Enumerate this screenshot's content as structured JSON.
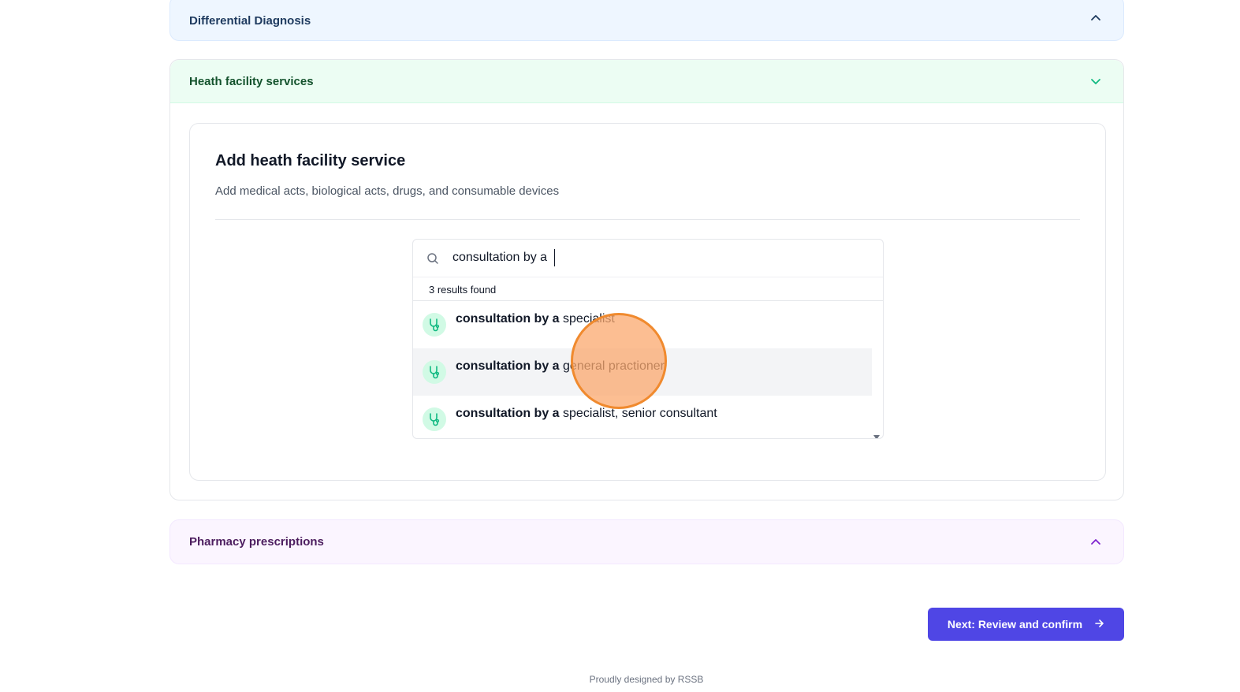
{
  "sections": {
    "differential_diagnosis": {
      "title": "Differential Diagnosis",
      "expanded": false
    },
    "health_facility_services": {
      "title": "Heath facility services",
      "expanded": true
    },
    "pharmacy_prescriptions": {
      "title": "Pharmacy prescriptions",
      "expanded": false
    }
  },
  "add_service": {
    "title": "Add heath facility service",
    "subtitle": "Add medical acts, biological acts, drugs, and consumable devices"
  },
  "search": {
    "value": "consultation by a ",
    "results_count": "3 results found",
    "results": [
      {
        "match": "consultation by a",
        "rest": " specialist",
        "icon": "stethoscope-icon"
      },
      {
        "match": "consultation by a",
        "rest": " general practioner",
        "icon": "stethoscope-icon"
      },
      {
        "match": "consultation by a",
        "rest": " specialist, senior consultant",
        "icon": "stethoscope-icon"
      }
    ]
  },
  "actions": {
    "next_label": "Next: Review and confirm"
  },
  "footer": {
    "text": "Proudly designed by RSSB"
  },
  "colors": {
    "primary": "#4f46e5",
    "green_accent": "#10b981",
    "blue_panel": "#eef6ff",
    "green_panel": "#ecfdf3",
    "purple_panel": "#fbf5ff"
  }
}
